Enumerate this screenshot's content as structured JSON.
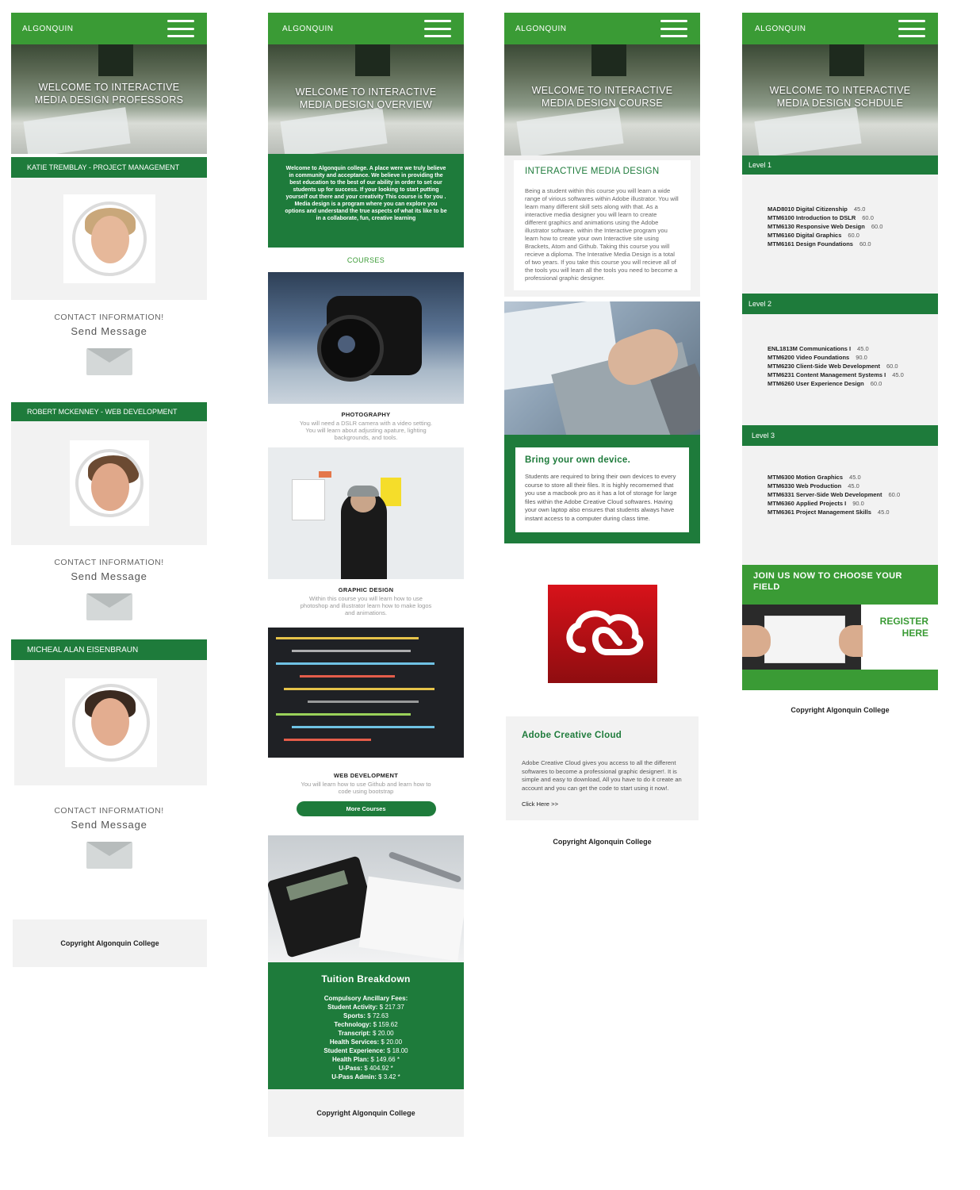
{
  "brand": "ALGONQUIN",
  "colors": {
    "primary_green": "#3a9b35",
    "dark_green": "#1e7b3b",
    "panel_gray": "#f2f2f2"
  },
  "icons": {
    "menu": "hamburger-menu-icon",
    "mail": "envelope-icon",
    "adobe": "adobe-creative-cloud-logo"
  },
  "professors": {
    "hero_title": "WELCOME TO INTERACTIVE MEDIA DESIGN PROFESSORS",
    "contact_label": "CONTACT INFORMATION!",
    "send_label": "Send Message",
    "people": [
      {
        "header": "KATIE TREMBLAY - PROJECT MANAGEMENT"
      },
      {
        "header": "ROBERT MCKENNEY - WEB DEVELOPMENT"
      },
      {
        "header": "MICHEAL ALAN EISENBRAUN"
      }
    ],
    "footer": "Copyright Algonquin College"
  },
  "overview": {
    "hero_title": "WELCOME TO INTERACTIVE MEDIA DESIGN OVERVIEW",
    "intro": "Welcome to Algonquin college. A place were we truly believe in community and acceptance. We believe in providing the best education to the best of our ability in order to set our students up for success. If your looking to start putting yourself out there and your creativity This course is for you . Media design is a program where you can explore you options and understand the true aspects of what its like to be in a collaborate, fun, creative learning",
    "courses_heading": "COURSES",
    "courses": [
      {
        "title": "PHOTOGRAPHY",
        "desc": "You will need a DSLR camera with a video setting. You will learn about adjusting apature, lighting backgrounds, and tools."
      },
      {
        "title": "GRAPHIC DESIGN",
        "desc": "Within this course you will learn how to use photoshop and illustrator learn how to make logos and animations."
      },
      {
        "title": "WEB DEVELOPMENT",
        "desc": "You will learn how to use Github and learn how to code using bootstrap"
      }
    ],
    "more_button": "More Courses",
    "tuition": {
      "title": "Tuition Breakdown",
      "heading": "Compulsory Ancillary Fees:",
      "fees": [
        {
          "label": "Student Activity:",
          "value": "$ 217.37"
        },
        {
          "label": "Sports:",
          "value": "$ 72.63"
        },
        {
          "label": "Technology:",
          "value": "$ 159.62"
        },
        {
          "label": "Transcript:",
          "value": "$ 20.00"
        },
        {
          "label": "Health Services:",
          "value": "$ 20.00"
        },
        {
          "label": "Student Experience:",
          "value": "$ 18.00"
        },
        {
          "label": "Health Plan:",
          "value": "$ 149.66 *"
        },
        {
          "label": "U-Pass:",
          "value": "$ 404.92 *"
        },
        {
          "label": "U-Pass Admin:",
          "value": "$ 3.42 *"
        }
      ]
    },
    "footer": "Copyright Algonquin College"
  },
  "course": {
    "hero_title": "WELCOME TO INTERACTIVE MEDIA DESIGN COURSE",
    "section_title": "INTERACTIVE MEDIA DESIGN",
    "section_body": "Being a student within this course you will learn a wide range of virious softwares within Adobe illustrator. You will learn many different skill sets along with that. As a interactive media designer you will learn to create different graphics and animations using the Adobe illustrator software. within the Interactive program you learn how to create your own Interactive site using Brackets, Atom and Github. Taking this course you will recieve a diploma. The Interative Media Design is a total of two years. If you take this course you will recieve all of the tools you will learn all the tools you need to become a professional graphic designer.",
    "device_title": "Bring your own device.",
    "device_body": "Students are required to bring their own devices to every course to store all their files. It is highly recomemed that you use a macbook pro as it has a lot of storage for large files within the Adobe Creative Cloud softwares. Having your own laptop also ensures that students always have instant access to a computer during class time.",
    "adobe_title": "Adobe Creative Cloud",
    "adobe_body": "Adobe Creative Cloud gives you access to all the different softwares to become a professional graphic designer!. It is simple and easy to download, All you have to do it create an account and you can get the code to start using it now!.",
    "adobe_link": "Click Here >>",
    "footer": "Copyright Algonquin College"
  },
  "schedule": {
    "hero_title": "WELCOME TO INTERACTIVE MEDIA DESIGN SCHDULE",
    "levels": [
      {
        "label": "Level 1",
        "rows": [
          {
            "code": "MAD8010",
            "name": "Digital Citizenship",
            "credit": "45.0"
          },
          {
            "code": "MTM6100",
            "name": "Introduction to DSLR",
            "credit": "60.0"
          },
          {
            "code": "MTM6130",
            "name": "Responsive Web Design",
            "credit": "60.0"
          },
          {
            "code": "MTM6160",
            "name": "Digital Graphics",
            "credit": "60.0"
          },
          {
            "code": "MTM6161",
            "name": "Design Foundations",
            "credit": "60.0"
          }
        ]
      },
      {
        "label": "Level 2",
        "rows": [
          {
            "code": "ENL1813M",
            "name": "Communications I",
            "credit": "45.0"
          },
          {
            "code": "MTM6200",
            "name": "Video Foundations",
            "credit": "90.0"
          },
          {
            "code": "MTM6230",
            "name": "Client-Side Web Development",
            "credit": "60.0"
          },
          {
            "code": "MTM6231",
            "name": "Content Management Systems I",
            "credit": "45.0"
          },
          {
            "code": "MTM6260",
            "name": "User Experience Design",
            "credit": "60.0"
          }
        ]
      },
      {
        "label": "Level 3",
        "rows": [
          {
            "code": "MTM6300",
            "name": "Motion Graphics",
            "credit": "45.0"
          },
          {
            "code": "MTM6330",
            "name": "Web Production",
            "credit": "45.0"
          },
          {
            "code": "MTM6331",
            "name": "Server-Side Web Development",
            "credit": "60.0"
          },
          {
            "code": "MTM6360",
            "name": "Applied Projects I",
            "credit": "90.0"
          },
          {
            "code": "MTM6361",
            "name": "Project Management Skills",
            "credit": "45.0"
          }
        ]
      }
    ],
    "join_title": "JOIN US NOW TO CHOOSE YOUR FIELD",
    "register": "REGISTER HERE",
    "footer": "Copyright Algonquin College"
  }
}
